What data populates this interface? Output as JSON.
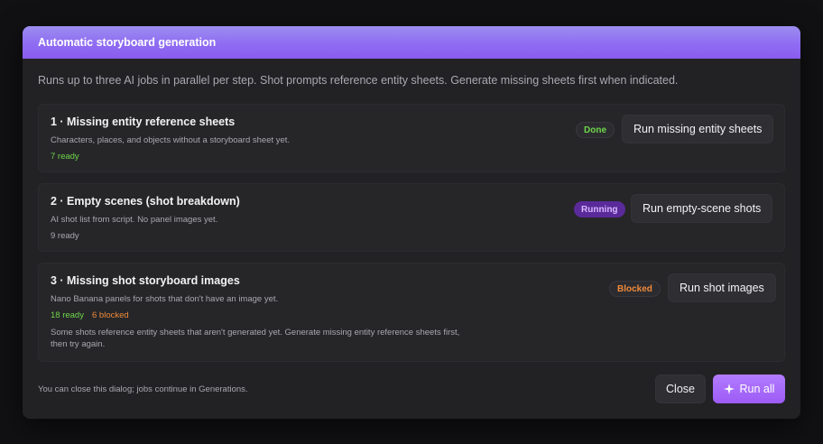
{
  "dialog": {
    "title": "Automatic storyboard generation",
    "intro": "Runs up to three AI jobs in parallel per step. Shot prompts reference entity sheets. Generate missing sheets first when indicated."
  },
  "steps": [
    {
      "title": "1 · Missing entity reference sheets",
      "description": "Characters, places, and objects without a storyboard sheet yet.",
      "ready": "7 ready",
      "status": "Done",
      "button": "Run missing entity sheets"
    },
    {
      "title": "2 · Empty scenes (shot breakdown)",
      "description": "AI shot list from script. No panel images yet.",
      "ready": "9 ready",
      "status": "Running",
      "button": "Run empty-scene shots"
    },
    {
      "title": "3 · Missing shot storyboard images",
      "description": "Nano Banana panels for shots that don't have an image yet.",
      "ready": "18 ready",
      "blocked": "6 blocked",
      "note": "Some shots reference entity sheets that aren't generated yet. Generate missing entity reference sheets first, then try again.",
      "status": "Blocked",
      "button": "Run shot images"
    }
  ],
  "footer": {
    "note": "You can close this dialog; jobs continue in Generations.",
    "close_label": "Close",
    "run_all_label": "Run all",
    "run_all_icon": "sparkle-icon"
  },
  "colors": {
    "accent": "#9d5cf5",
    "done": "#6fd64a",
    "blocked": "#f08a3a",
    "running_bg": "#5a2a9a"
  }
}
